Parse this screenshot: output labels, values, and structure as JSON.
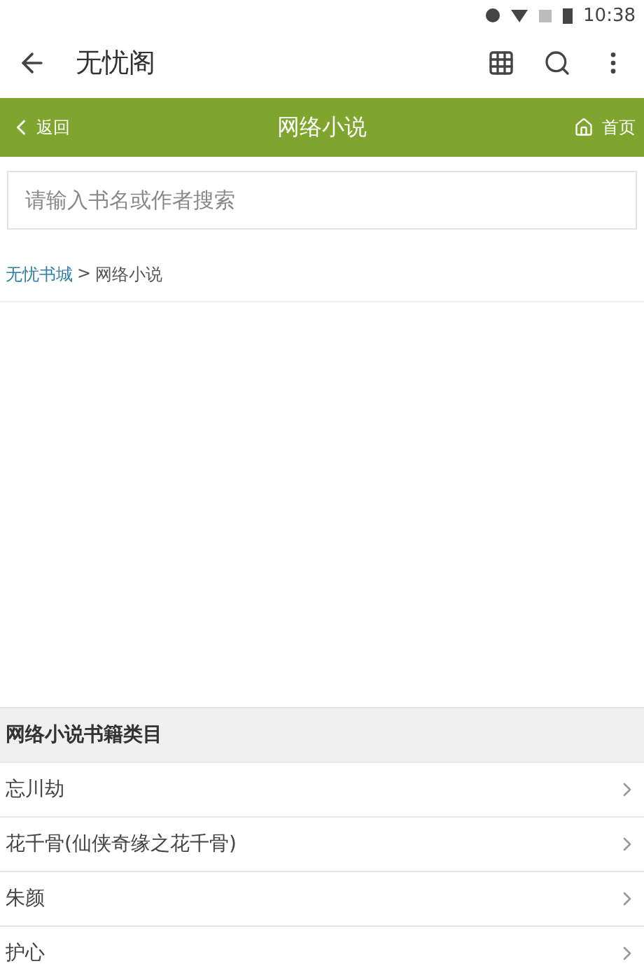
{
  "status_bar": {
    "time": "10:38"
  },
  "app_bar": {
    "title": "无忧阁"
  },
  "nav_bar": {
    "back": "返回",
    "title": "网络小说",
    "home": "首页"
  },
  "search": {
    "placeholder": "请输入书名或作者搜索"
  },
  "breadcrumb": {
    "link": "无忧书城",
    "separator": ">",
    "current": "网络小说"
  },
  "section": {
    "title": "网络小说书籍类目"
  },
  "books": [
    {
      "title": "忘川劫"
    },
    {
      "title": "花千骨(仙侠奇缘之花千骨)"
    },
    {
      "title": "朱颜"
    },
    {
      "title": "护心"
    }
  ]
}
